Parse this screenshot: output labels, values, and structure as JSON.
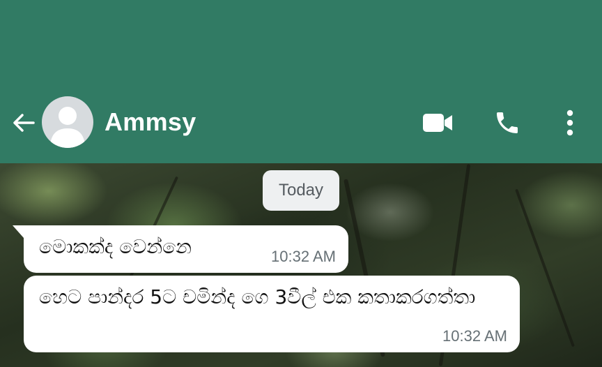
{
  "header": {
    "contact_name": "Ammsy",
    "icons": {
      "back": "arrow-left-icon",
      "avatar": "person-placeholder-icon",
      "video": "video-camera-icon",
      "call": "phone-icon",
      "menu": "vertical-dots-icon"
    },
    "colors": {
      "bar": "#317b64",
      "icon": "#ffffff"
    }
  },
  "chat": {
    "date_chip": "Today",
    "messages": [
      {
        "text": "මොකක්ද වෙන්නෙ",
        "time": "10:32 AM"
      },
      {
        "text": "හෙට පාන්දර 5ට චමින්ද ගෙ 3වීල් එක කතාකරගත්තා",
        "time": "10:32 AM"
      }
    ],
    "colors": {
      "bubble": "#ffffff",
      "time": "#667075",
      "chip": "#eef0f1"
    }
  }
}
